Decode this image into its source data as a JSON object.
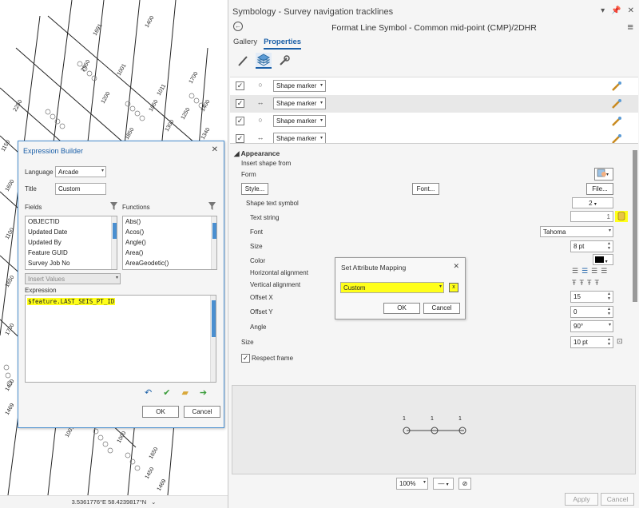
{
  "map": {
    "coordinates": "3.5361776°E 58.4239817°N",
    "labels": [
      "1691",
      "1400",
      "1001",
      "2950",
      "1011",
      "1700",
      "1200",
      "1250",
      "1050",
      "1400",
      "1300",
      "1850",
      "2250",
      "1150",
      "1340",
      "1600",
      "1100",
      "1650",
      "1700",
      "1001",
      "1400",
      "1469",
      "1000",
      "1650",
      "1450",
      "1469"
    ]
  },
  "symbology": {
    "pane_title": "Symbology - Survey navigation tracklines",
    "header_title": "Format Line Symbol - Common mid-point (CMP)/2DHR",
    "tabs": [
      "Gallery",
      "Properties"
    ],
    "layers": [
      {
        "checked": true,
        "symbol": "○",
        "type": "Shape marker"
      },
      {
        "checked": true,
        "symbol": "↔",
        "type": "Shape marker"
      },
      {
        "checked": true,
        "symbol": "○",
        "type": "Shape marker"
      },
      {
        "checked": true,
        "symbol": "↔",
        "type": "Shape marker"
      }
    ],
    "appearance": {
      "section": "Appearance",
      "insert_shape_from": "Insert shape from",
      "form": "Form",
      "style_btn": "Style...",
      "font_btn": "Font...",
      "file_btn": "File...",
      "shape_text_symbol": "Shape text symbol",
      "shape_text_value": "2",
      "text_string": "Text string",
      "text_string_value": "1",
      "font_label": "Font",
      "font_value": "Tahoma",
      "size_label": "Size",
      "size_value": "8 pt",
      "color_label": "Color",
      "h_align": "Horizontal alignment",
      "v_align": "Vertical alignment",
      "offset_x": "Offset X",
      "offset_x_value": "15",
      "offset_y": "Offset Y",
      "offset_y_value": "0",
      "angle": "Angle",
      "angle_value": "90°",
      "size2_label": "Size",
      "size2_value": "10 pt",
      "respect_frame": "Respect frame"
    },
    "preview": {
      "marker_labels": [
        "1",
        "1",
        "1"
      ],
      "zoom": "100%"
    },
    "footer": {
      "apply": "Apply",
      "cancel": "Cancel"
    }
  },
  "expression_builder": {
    "title": "Expression Builder",
    "language_label": "Language",
    "language_value": "Arcade",
    "title_label": "Title",
    "title_value": "Custom",
    "fields_label": "Fields",
    "functions_label": "Functions",
    "fields": [
      "OBJECTID",
      "Updated Date",
      "Updated By",
      "Feature GUID",
      "Survey Job No"
    ],
    "functions": [
      "Abs()",
      "Acos()",
      "Angle()",
      "Area()",
      "AreaGeodetic()"
    ],
    "insert_values": "Insert Values",
    "expression_label": "Expression",
    "expression": "$feature.LAST_SEIS_PT_ID",
    "ok": "OK",
    "cancel": "Cancel"
  },
  "attribute_mapping": {
    "title": "Set Attribute Mapping",
    "value": "Custom",
    "ok": "OK",
    "cancel": "Cancel"
  }
}
